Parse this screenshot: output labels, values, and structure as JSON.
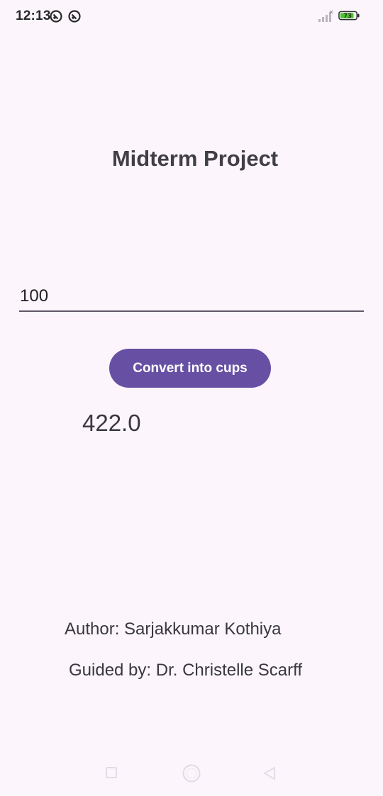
{
  "status_bar": {
    "time": "12:13",
    "battery_level": "73",
    "icons": [
      "notification-icon",
      "notification-icon",
      "signal-icon",
      "battery-icon"
    ]
  },
  "app": {
    "title": "Midterm Project"
  },
  "input": {
    "value": "100"
  },
  "convert_button": {
    "label": "Convert into cups"
  },
  "result": {
    "value": "422.0"
  },
  "footer": {
    "author": "Author: Sarjakkumar Kothiya",
    "guided_by": "Guided by: Dr. Christelle Scarff"
  },
  "nav_bar": {
    "buttons": [
      "recents-button",
      "home-button",
      "back-button"
    ]
  },
  "colors": {
    "background": "#FCF6FC",
    "accent": "#6750A4",
    "text": "#3a3740"
  }
}
